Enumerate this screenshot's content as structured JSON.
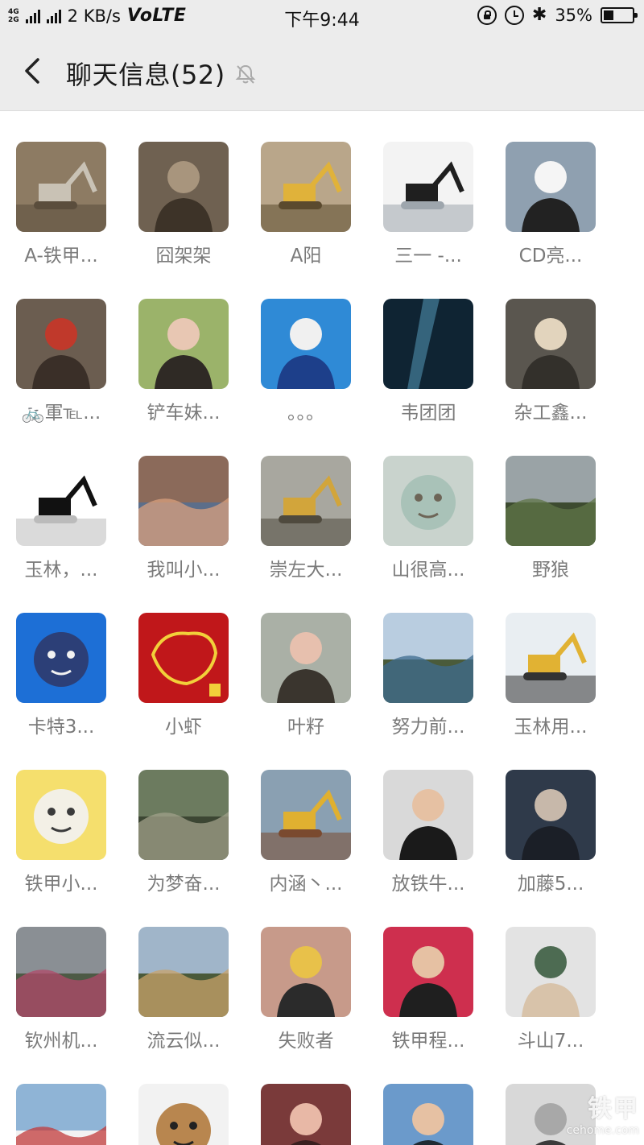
{
  "status_bar": {
    "net_top": "4G",
    "net_bottom": "2G",
    "speed": "2 KB/s",
    "volte": "VoLTE",
    "time": "下午9:44",
    "battery": "35%",
    "battery_level": 0.35
  },
  "header": {
    "title": "聊天信息(52)"
  },
  "members": [
    {
      "name": "A-铁甲...",
      "avatar": "excavator-photo",
      "colors": [
        "#8d7b63",
        "#c9c2b5",
        "#5a4d3c"
      ]
    },
    {
      "name": "囧架架",
      "avatar": "child-photo",
      "colors": [
        "#6f6151",
        "#a8957d",
        "#3d3328"
      ]
    },
    {
      "name": "A阳",
      "avatar": "excavator-photo",
      "colors": [
        "#b9a68a",
        "#e0b23a",
        "#5b4a2e"
      ]
    },
    {
      "name": "三一 -...",
      "avatar": "excavator-drawing",
      "colors": [
        "#f3f3f3",
        "#1f1f1f",
        "#9ea6ad"
      ]
    },
    {
      "name": "CD亮...",
      "avatar": "person-photo",
      "colors": [
        "#8fa0b0",
        "#f5f5f5",
        "#222222"
      ]
    },
    {
      "name": "🚲軍℡...",
      "avatar": "child-photo",
      "colors": [
        "#6b5d50",
        "#c0392b",
        "#3a2f28"
      ]
    },
    {
      "name": "铲车妹...",
      "avatar": "woman-photo",
      "colors": [
        "#9bb36a",
        "#e8c7b3",
        "#2f2a25"
      ]
    },
    {
      "name": "。。。",
      "avatar": "cat-photo",
      "colors": [
        "#2f8ad6",
        "#f0f0f0",
        "#1d3f8a"
      ]
    },
    {
      "name": "韦团团",
      "avatar": "dark-photo",
      "colors": [
        "#0f2433",
        "#4f8fae",
        "#0a0f14"
      ]
    },
    {
      "name": "杂工鑫...",
      "avatar": "lion-photo",
      "colors": [
        "#5a564f",
        "#e2d4bd",
        "#33302b"
      ]
    },
    {
      "name": "玉林，...",
      "avatar": "excavator-drawing",
      "colors": [
        "#ffffff",
        "#111111",
        "#bbbbbb"
      ]
    },
    {
      "name": "我叫小...",
      "avatar": "clouds-photo",
      "colors": [
        "#8b6a5a",
        "#d8a07e",
        "#5c6e8a"
      ]
    },
    {
      "name": "崇左大...",
      "avatar": "excavator-photo",
      "colors": [
        "#a8a79f",
        "#d2a53b",
        "#4f4a3e"
      ]
    },
    {
      "name": "山很高...",
      "avatar": "anime-drawing",
      "colors": [
        "#c9d3cd",
        "#a9c2b8",
        "#6d6557"
      ]
    },
    {
      "name": "野狼",
      "avatar": "landscape-photo",
      "colors": [
        "#9aa3a6",
        "#5f7447",
        "#3d4b30"
      ]
    },
    {
      "name": "卡特3...",
      "avatar": "cartoon-cat",
      "colors": [
        "#1d6fd6",
        "#2c3f77",
        "#f2f2f2"
      ]
    },
    {
      "name": "小虾",
      "avatar": "map-china",
      "colors": [
        "#c0171a",
        "#f2d03a",
        "#7a0a0c"
      ]
    },
    {
      "name": "叶籽",
      "avatar": "boy-photo",
      "colors": [
        "#aab0a6",
        "#e7c0ae",
        "#3a352e"
      ]
    },
    {
      "name": "努力前...",
      "avatar": "landscape-photo",
      "colors": [
        "#b9cde0",
        "#3f6b8f",
        "#4a5b3a"
      ]
    },
    {
      "name": "玉林用...",
      "avatar": "excavator-photo",
      "colors": [
        "#e9eef2",
        "#e1b233",
        "#333333"
      ]
    },
    {
      "name": "铁甲小...",
      "avatar": "pikachu-cartoon",
      "colors": [
        "#f5df6d",
        "#f3f0e6",
        "#3b3b3b"
      ]
    },
    {
      "name": "为梦奋...",
      "avatar": "road-photo",
      "colors": [
        "#6c7b5f",
        "#a0a089",
        "#3c4633"
      ]
    },
    {
      "name": "内涵丶...",
      "avatar": "excavator-photo",
      "colors": [
        "#8aa0b2",
        "#e0b030",
        "#7a4a2f"
      ]
    },
    {
      "name": "放铁牛...",
      "avatar": "man-photo",
      "colors": [
        "#d9d9d9",
        "#e6c1a3",
        "#1a1a1a"
      ]
    },
    {
      "name": "加藤5...",
      "avatar": "man-photo",
      "colors": [
        "#2f3a4a",
        "#c7b8aa",
        "#1b1f27"
      ]
    },
    {
      "name": "钦州机...",
      "avatar": "flowers-photo",
      "colors": [
        "#8a8f94",
        "#b04a6a",
        "#4d5a45"
      ]
    },
    {
      "name": "流云似...",
      "avatar": "camel-photo",
      "colors": [
        "#a0b5c9",
        "#c8a36a",
        "#4a5a3a"
      ]
    },
    {
      "name": "失败者",
      "avatar": "man-photo",
      "colors": [
        "#c79a8a",
        "#e8c14a",
        "#2b2b2b"
      ]
    },
    {
      "name": "铁甲程...",
      "avatar": "man-photo",
      "colors": [
        "#ce2f4e",
        "#e6c1a3",
        "#1f1f1f"
      ]
    },
    {
      "name": "斗山7...",
      "avatar": "child-photo",
      "colors": [
        "#e3e3e3",
        "#4d6b52",
        "#d8c3aa"
      ]
    },
    {
      "name": "",
      "avatar": "car-photo",
      "colors": [
        "#8fb4d6",
        "#c23b3b",
        "#f2f2f2"
      ]
    },
    {
      "name": "",
      "avatar": "caricature-drawing",
      "colors": [
        "#f2f2f2",
        "#b8864f",
        "#222222"
      ]
    },
    {
      "name": "",
      "avatar": "woman-photo",
      "colors": [
        "#7a3a3a",
        "#e8b8a6",
        "#3a1f1f"
      ]
    },
    {
      "name": "",
      "avatar": "man-photo",
      "colors": [
        "#6b9acb",
        "#e6c1a3",
        "#1f2a33"
      ]
    },
    {
      "name": "",
      "avatar": "person-photo",
      "colors": [
        "#d8d8d8",
        "#a8a8a8",
        "#3b3b3b"
      ]
    }
  ],
  "watermark": {
    "text_main": "铁甲",
    "text_sub": "cehome.com"
  }
}
